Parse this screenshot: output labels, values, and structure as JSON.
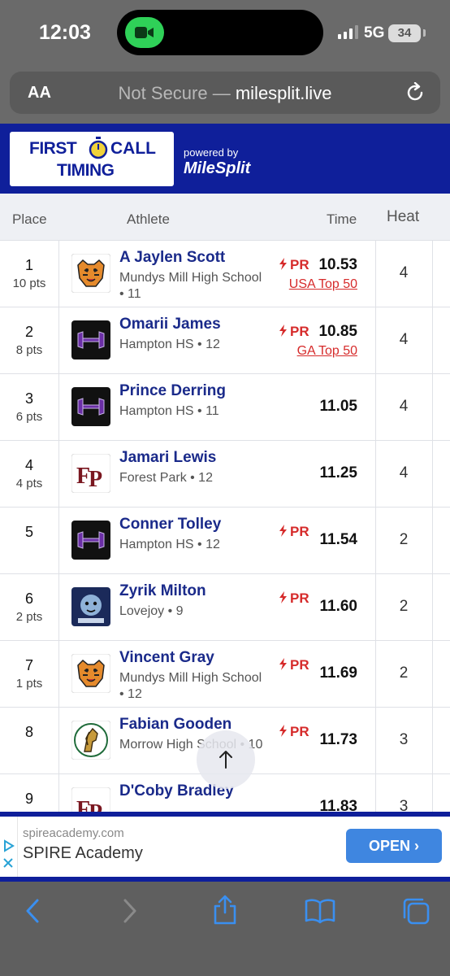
{
  "status": {
    "time": "12:03",
    "network": "5G",
    "battery": "34"
  },
  "urlbar": {
    "text_size": "AA",
    "security": "Not Secure",
    "separator": " — ",
    "domain": "milesplit.live"
  },
  "header": {
    "logo_line1": "FIRST",
    "logo_line2": "CALL",
    "logo_line3": "TIMING",
    "powered_by": "powered by",
    "brand": "MileSplit"
  },
  "table": {
    "columns": {
      "place": "Place",
      "athlete": "Athlete",
      "time": "Time",
      "heat": "Heat"
    },
    "rows": [
      {
        "place": "1",
        "pts": "10 pts",
        "name": "A Jaylen Scott",
        "school": "Mundys Mill High School • 11",
        "pr": "PR",
        "time": "10.53",
        "rank": "USA Top 50",
        "heat": "4",
        "logo": "tiger"
      },
      {
        "place": "2",
        "pts": "8 pts",
        "name": "Omarii James",
        "school": "Hampton HS • 12",
        "pr": "PR",
        "time": "10.85",
        "rank": "GA Top 50",
        "heat": "4",
        "logo": "hampton"
      },
      {
        "place": "3",
        "pts": "6 pts",
        "name": "Prince Derring",
        "school": "Hampton HS • 11",
        "pr": "",
        "time": "11.05",
        "rank": "",
        "heat": "4",
        "logo": "hampton"
      },
      {
        "place": "4",
        "pts": "4 pts",
        "name": "Jamari Lewis",
        "school": "Forest Park • 12",
        "pr": "",
        "time": "11.25",
        "rank": "",
        "heat": "4",
        "logo": "fp"
      },
      {
        "place": "5",
        "pts": "",
        "name": "Conner Tolley",
        "school": "Hampton HS • 12",
        "pr": "PR",
        "time": "11.54",
        "rank": "",
        "heat": "2",
        "logo": "hampton"
      },
      {
        "place": "6",
        "pts": "2 pts",
        "name": "Zyrik Milton",
        "school": "Lovejoy • 9",
        "pr": "PR",
        "time": "11.60",
        "rank": "",
        "heat": "2",
        "logo": "wildcats"
      },
      {
        "place": "7",
        "pts": "1 pts",
        "name": "Vincent Gray",
        "school": "Mundys Mill High School • 12",
        "pr": "PR",
        "time": "11.69",
        "rank": "",
        "heat": "2",
        "logo": "tiger"
      },
      {
        "place": "8",
        "pts": "",
        "name": "Fabian Gooden",
        "school": "Morrow High School • 10",
        "pr": "PR",
        "time": "11.73",
        "rank": "",
        "heat": "3",
        "logo": "mustang"
      },
      {
        "place": "9",
        "pts": "",
        "name": "D'Coby Bradley",
        "school": "",
        "pr": "",
        "time": "11.83",
        "rank": "",
        "heat": "3",
        "logo": "fp"
      }
    ]
  },
  "ad": {
    "url": "spireacademy.com",
    "title": "SPIRE Academy",
    "button": "OPEN ›"
  },
  "colors": {
    "brand_blue": "#0f1f9a",
    "pr_red": "#d62b2b",
    "link_blue": "#1a2a8a",
    "ad_button": "#3f86e0"
  }
}
